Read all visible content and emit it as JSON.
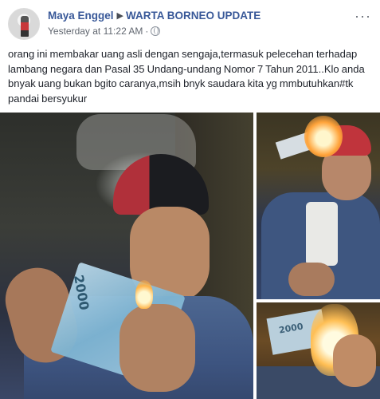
{
  "post": {
    "author": "Maya Enggel",
    "separator": "▶",
    "group": "WARTA BORNEO UPDATE",
    "timestamp": "Yesterday at 11:22 AM",
    "privacy_icon": "globe-icon",
    "more_label": "···",
    "caption": "orang ini membakar uang asli dengan sengaja,termasuk pelecehan terhadap lambang negara dan Pasal 35 Undang-undang Nomor 7 Tahun 2011..Klo anda bnyak uang bukan bgito caranya,msih bnyk saudara kita yg mmbutuhkan#tk pandai bersyukur"
  },
  "photos": {
    "main_banknote_label": "2000",
    "bottom_banknote_label": "2000"
  },
  "colors": {
    "link_blue": "#385898",
    "meta_gray": "#616770",
    "text": "#1d2129"
  }
}
